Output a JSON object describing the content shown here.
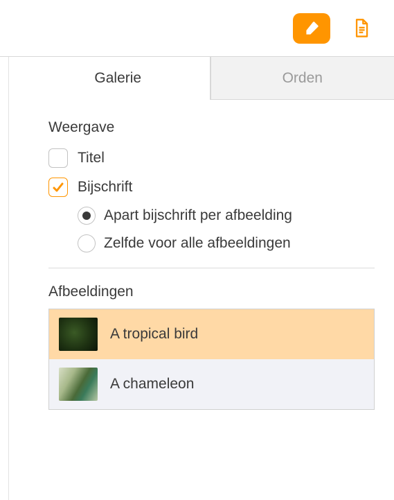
{
  "toolbar": {
    "format_icon": "paintbrush-icon",
    "document_icon": "document-icon"
  },
  "tabs": {
    "gallery": "Galerie",
    "arrange": "Orden"
  },
  "display": {
    "heading": "Weergave",
    "title_label": "Titel",
    "title_checked": false,
    "caption_label": "Bijschrift",
    "caption_checked": true,
    "caption_mode_options": {
      "separate": "Apart bijschrift per afbeelding",
      "same": "Zelfde voor alle afbeeldingen"
    },
    "caption_mode_selected": "separate"
  },
  "images": {
    "heading": "Afbeeldingen",
    "items": [
      {
        "name": "A tropical bird",
        "selected": true,
        "thumb": "bird"
      },
      {
        "name": "A chameleon",
        "selected": false,
        "thumb": "chameleon"
      }
    ]
  },
  "colors": {
    "accent": "#ff9500"
  }
}
